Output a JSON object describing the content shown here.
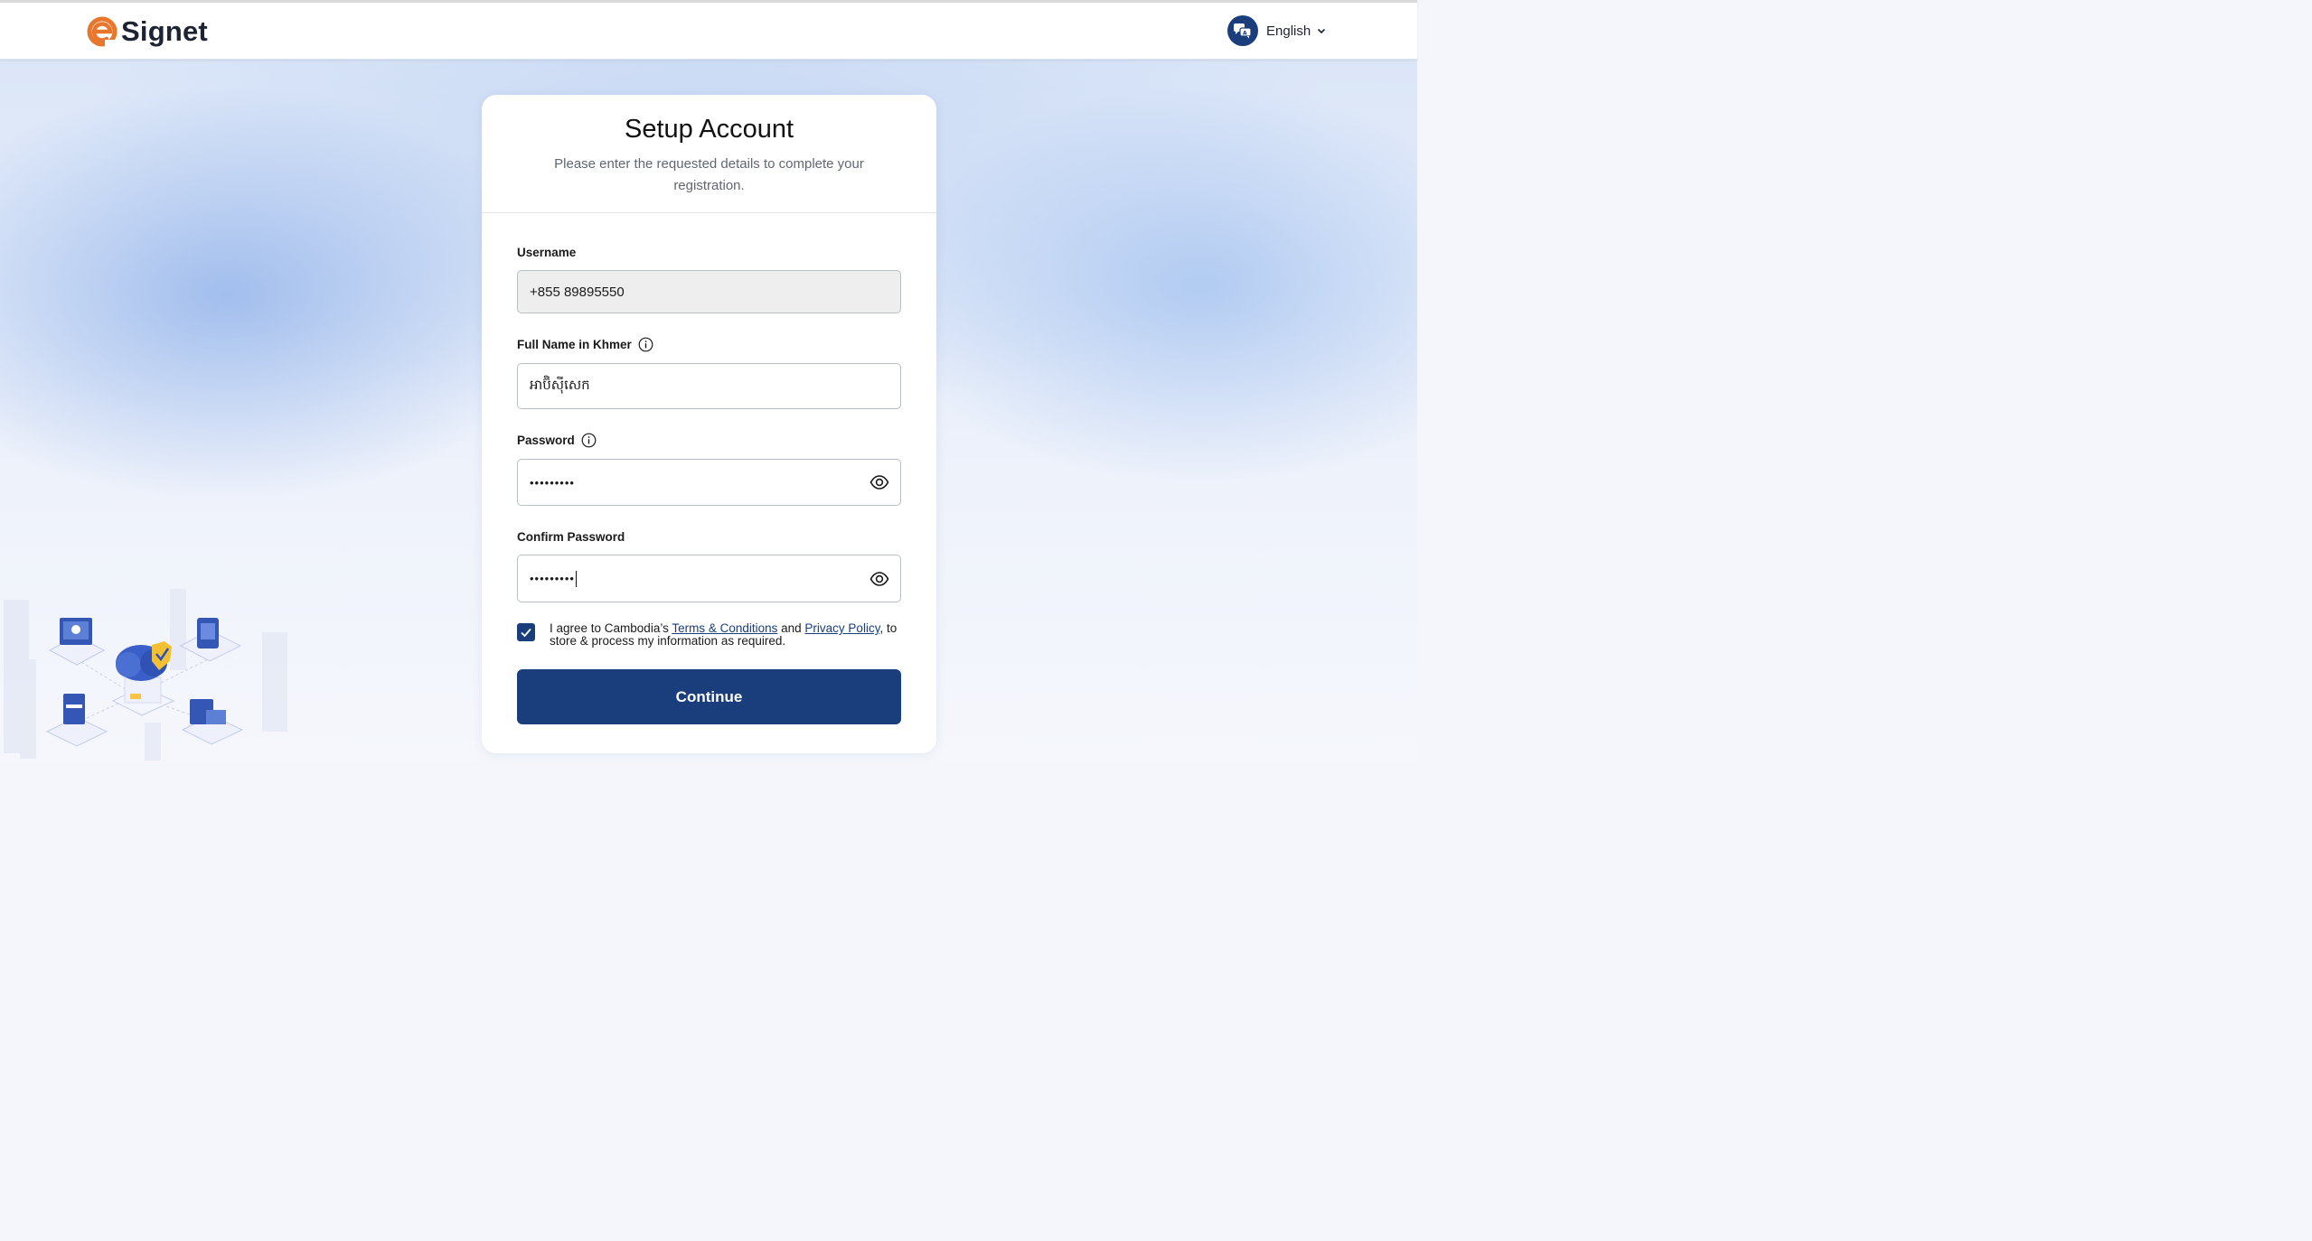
{
  "header": {
    "brand": "Signet",
    "language": "English"
  },
  "form": {
    "title": "Setup Account",
    "subtitle": "Please enter the requested details to complete your registration.",
    "username": {
      "label": "Username",
      "value": "+855 89895550"
    },
    "full_name": {
      "label": "Full Name in Khmer",
      "value": "អាប៊ិស៊ីសេក"
    },
    "password": {
      "label": "Password",
      "value": "•••••••••"
    },
    "confirm_password": {
      "label": "Confirm Password",
      "value": "•••••••••"
    },
    "agree": {
      "prefix": "I agree to Cambodia’s ",
      "terms_link": "Terms & Conditions",
      "middle": " and ",
      "privacy_link": "Privacy Policy",
      "suffix": ", to store & process my information as required.",
      "checked": true
    },
    "continue_label": "Continue"
  },
  "colors": {
    "primary": "#1a3e7c",
    "logo_accent": "#e8762d"
  }
}
